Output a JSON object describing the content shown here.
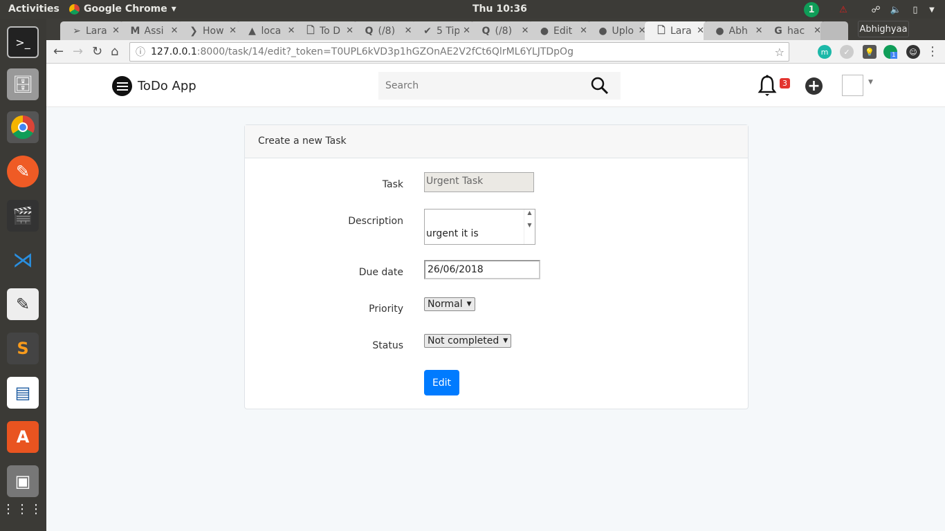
{
  "system": {
    "activities": "Activities",
    "app_name": "Google Chrome",
    "clock": "Thu 10:36",
    "notification_count": "1"
  },
  "launcher": [
    "terminal-icon",
    "files-icon",
    "chrome-icon",
    "postman-icon",
    "video-editor-icon",
    "vscode-icon",
    "text-editor-icon",
    "sublime-icon",
    "writer-icon",
    "software-center-icon",
    "image-viewer-icon",
    "apps-grid-icon"
  ],
  "tabs": [
    {
      "label": "Lara",
      "icon": "➢"
    },
    {
      "label": "Assi",
      "icon": "M"
    },
    {
      "label": "How",
      "icon": "❯"
    },
    {
      "label": "loca",
      "icon": "▲"
    },
    {
      "label": "To D",
      "icon": "🗋"
    },
    {
      "label": "(/8)",
      "icon": "Q"
    },
    {
      "label": "5 Tip",
      "icon": "✔"
    },
    {
      "label": "(/8)",
      "icon": "Q"
    },
    {
      "label": "Edit",
      "icon": "●"
    },
    {
      "label": "Uplo",
      "icon": "●"
    },
    {
      "label": "Lara",
      "icon": "🗋",
      "active": true
    },
    {
      "label": "Abh",
      "icon": "●"
    },
    {
      "label": "hac",
      "icon": "G"
    }
  ],
  "profile": "Abhighyaa",
  "address": {
    "host": "127.0.0.1",
    "rest": ":8000/task/14/edit?_token=T0UPL6kVD3p1hGZOnAE2V2fCt6QlrML6YLJTDpOg"
  },
  "extension_badge": "1",
  "nav": {
    "brand": "ToDo App",
    "search_placeholder": "Search",
    "notifications": "3"
  },
  "card": {
    "title": "Create a new Task",
    "task_label": "Task",
    "task_value": "Urgent Task",
    "desc_label": "Description",
    "desc_value": "urgent it is",
    "due_label": "Due date",
    "due_value": "26/06/2018",
    "priority_label": "Priority",
    "priority_value": "Normal",
    "status_label": "Status",
    "status_value": "Not completed",
    "submit": "Edit"
  },
  "colors": {
    "primary": "#007bff",
    "badge": "#e3342f"
  }
}
